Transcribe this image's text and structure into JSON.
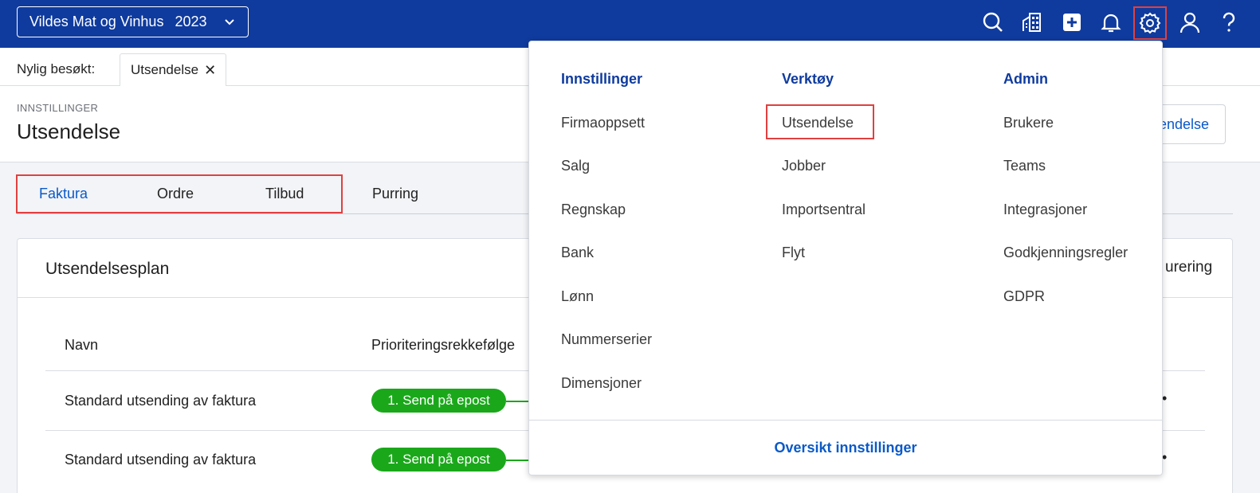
{
  "topbar": {
    "company": "Vildes Mat og Vinhus",
    "year": "2023",
    "icons": [
      "search-icon",
      "building-icon",
      "add-icon",
      "bell-icon",
      "gear-icon",
      "user-icon",
      "help-icon"
    ],
    "accent_color": "#0f3b9e"
  },
  "recent": {
    "label": "Nylig besøkt:",
    "tabs": [
      {
        "label": "Utsendelse",
        "close": "✕"
      }
    ]
  },
  "page": {
    "breadcrumb": "INNSTILLINGER",
    "title": "Utsendelse",
    "new_button": "endelse"
  },
  "tabs": [
    {
      "label": "Faktura",
      "active": true
    },
    {
      "label": "Ordre"
    },
    {
      "label": "Tilbud"
    },
    {
      "label": "Purring"
    }
  ],
  "card": {
    "title": "Utsendelsesplan",
    "right_label": "urering",
    "headers": [
      "Navn",
      "Prioriteringsrekkefølge"
    ],
    "rows": [
      {
        "name": "Standard utsending av faktura",
        "step": "1. Send på epost",
        "more": "•"
      },
      {
        "name": "Standard utsending av faktura",
        "step": "1. Send på epost",
        "more": "•"
      }
    ],
    "step_color": "#1aa81a"
  },
  "menu": {
    "columns": [
      {
        "heading": "Innstillinger",
        "items": [
          "Firmaoppsett",
          "Salg",
          "Regnskap",
          "Bank",
          "Lønn",
          "Nummerserier",
          "Dimensjoner"
        ]
      },
      {
        "heading": "Verktøy",
        "items": [
          "Utsendelse",
          "Jobber",
          "Importsentral",
          "Flyt"
        ]
      },
      {
        "heading": "Admin",
        "items": [
          "Brukere",
          "Teams",
          "Integrasjoner",
          "Godkjenningsregler",
          "GDPR"
        ]
      }
    ],
    "footer_link": "Oversikt innstillinger"
  }
}
